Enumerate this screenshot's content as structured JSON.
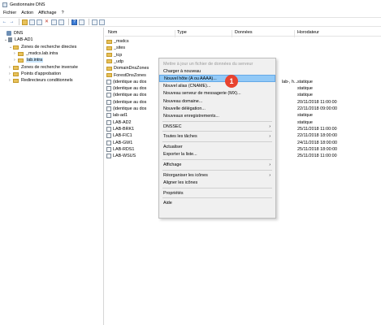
{
  "window": {
    "title": "Gestionnaire DNS"
  },
  "menu": [
    "Fichier",
    "Action",
    "Affichage",
    "?"
  ],
  "tree": [
    {
      "label": "DNS",
      "level": 0,
      "type": "dns",
      "exp": ""
    },
    {
      "label": "LAB-AD1",
      "level": 1,
      "type": "server",
      "exp": "⌄"
    },
    {
      "label": "Zones de recherche directes",
      "level": 2,
      "type": "folder",
      "exp": "⌄"
    },
    {
      "label": "_msdcs.lab.intra",
      "level": 3,
      "type": "folder",
      "exp": "›"
    },
    {
      "label": "lab.intra",
      "level": 3,
      "type": "folder",
      "exp": "›",
      "selected": true
    },
    {
      "label": "Zones de recherche inversée",
      "level": 2,
      "type": "folder",
      "exp": "›"
    },
    {
      "label": "Points d'approbation",
      "level": 2,
      "type": "folder",
      "exp": "›"
    },
    {
      "label": "Redirecteurs conditionnels",
      "level": 2,
      "type": "folder",
      "exp": "›"
    }
  ],
  "list": {
    "columns": [
      "Nom",
      "Type",
      "Données",
      "Horodateur"
    ],
    "rows": [
      {
        "name": "_msdcs",
        "icon": "folder",
        "ts": ""
      },
      {
        "name": "_sites",
        "icon": "folder",
        "ts": ""
      },
      {
        "name": "_tcp",
        "icon": "folder",
        "ts": ""
      },
      {
        "name": "_udp",
        "icon": "folder",
        "ts": ""
      },
      {
        "name": "DomainDnsZones",
        "icon": "folder",
        "ts": ""
      },
      {
        "name": "ForestDnsZones",
        "icon": "folder",
        "ts": ""
      },
      {
        "name": "(identique au dos",
        "icon": "record",
        "ts": "statique",
        "extra": "lab-, h..."
      },
      {
        "name": "(identique au dos",
        "icon": "record",
        "ts": "statique"
      },
      {
        "name": "(identique au dos",
        "icon": "record",
        "ts": "statique"
      },
      {
        "name": "(identique au dos",
        "icon": "record",
        "ts": "20/11/2018 11:00:00"
      },
      {
        "name": "(identique au dos",
        "icon": "record",
        "ts": "22/11/2018 09:00:00"
      },
      {
        "name": "lab-ad1",
        "icon": "record",
        "ts": "statique"
      },
      {
        "name": "LAB-AD2",
        "icon": "record",
        "ts": "statique"
      },
      {
        "name": "LAB-BRK1",
        "icon": "record",
        "ts": "25/11/2018 11:00:00"
      },
      {
        "name": "LAB-FIC1",
        "icon": "record",
        "ts": "22/11/2018 18:00:00"
      },
      {
        "name": "LAB-GW1",
        "icon": "record",
        "ts": "24/11/2018 18:00:00"
      },
      {
        "name": "LAB-RDS1",
        "icon": "record",
        "ts": "25/11/2018 18:00:00"
      },
      {
        "name": "LAB-WSUS",
        "icon": "record",
        "ts": "25/11/2018 11:00:00"
      }
    ]
  },
  "context_menu": {
    "items": [
      {
        "label": "Mettre à jour un fichier de données du serveur",
        "disabled": true
      },
      {
        "label": "Charger à nouveau"
      },
      {
        "label": "Nouvel hôte (A ou AAAA)...",
        "highlighted": true
      },
      {
        "label": "Nouvel alias (CNAME)..."
      },
      {
        "label": "Nouveau serveur de messagerie (MX)..."
      },
      {
        "label": "Nouveau domaine..."
      },
      {
        "label": "Nouvelle délégation..."
      },
      {
        "label": "Nouveaux enregistrements..."
      },
      {
        "sep": true
      },
      {
        "label": "DNSSEC",
        "submenu": true
      },
      {
        "sep": true
      },
      {
        "label": "Toutes les tâches",
        "submenu": true
      },
      {
        "sep": true
      },
      {
        "label": "Actualiser"
      },
      {
        "label": "Exporter la liste..."
      },
      {
        "sep": true
      },
      {
        "label": "Affichage",
        "submenu": true
      },
      {
        "sep": true
      },
      {
        "label": "Réorganiser les icônes",
        "submenu": true
      },
      {
        "label": "Aligner les icônes"
      },
      {
        "sep": true
      },
      {
        "label": "Propriétés"
      },
      {
        "sep": true
      },
      {
        "label": "Aide"
      }
    ]
  },
  "annotation": {
    "badge": "1",
    "color": "#e8432f"
  },
  "icons": [
    "back-icon",
    "forward-icon",
    "up-folder-icon",
    "show-tree-icon",
    "list-view-icon",
    "delete-icon",
    "refresh-icon",
    "export-icon",
    "help-icon",
    "properties-icon",
    "server-icon",
    "zone-icon"
  ]
}
